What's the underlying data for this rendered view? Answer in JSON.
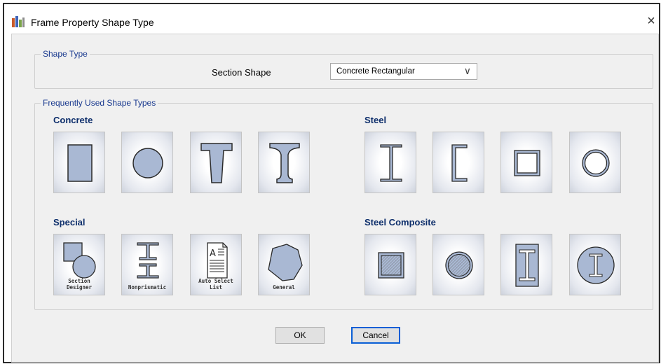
{
  "window": {
    "title": "Frame Property Shape Type",
    "close_glyph": "×"
  },
  "shape_type_group": {
    "label": "Shape Type",
    "section_shape_label": "Section Shape",
    "section_shape_value": "Concrete Rectangular",
    "dropdown_arrow": "∨"
  },
  "frequent_group": {
    "label": "Frequently Used Shape Types",
    "concrete": {
      "heading": "Concrete",
      "buttons": [
        "rectangular-icon",
        "circular-icon",
        "tee-icon",
        "i-section-icon"
      ]
    },
    "steel": {
      "heading": "Steel",
      "buttons": [
        "i-beam-icon",
        "channel-icon",
        "tube-icon",
        "pipe-icon"
      ]
    },
    "special": {
      "heading": "Special",
      "captions": [
        "Section Designer",
        "Nonprismatic",
        "Auto Select List",
        "General"
      ]
    },
    "steel_composite": {
      "heading": "Steel Composite",
      "buttons": [
        "filled-tube-icon",
        "filled-pipe-icon",
        "encased-i-rect-icon",
        "encased-i-circle-icon"
      ]
    }
  },
  "buttons": {
    "ok": "OK",
    "cancel": "Cancel"
  },
  "colors": {
    "shape_fill": "#a9b8d3",
    "shape_stroke": "#2a2a2a",
    "heading": "#0d2e6b",
    "default_border": "#0a5fd6"
  }
}
